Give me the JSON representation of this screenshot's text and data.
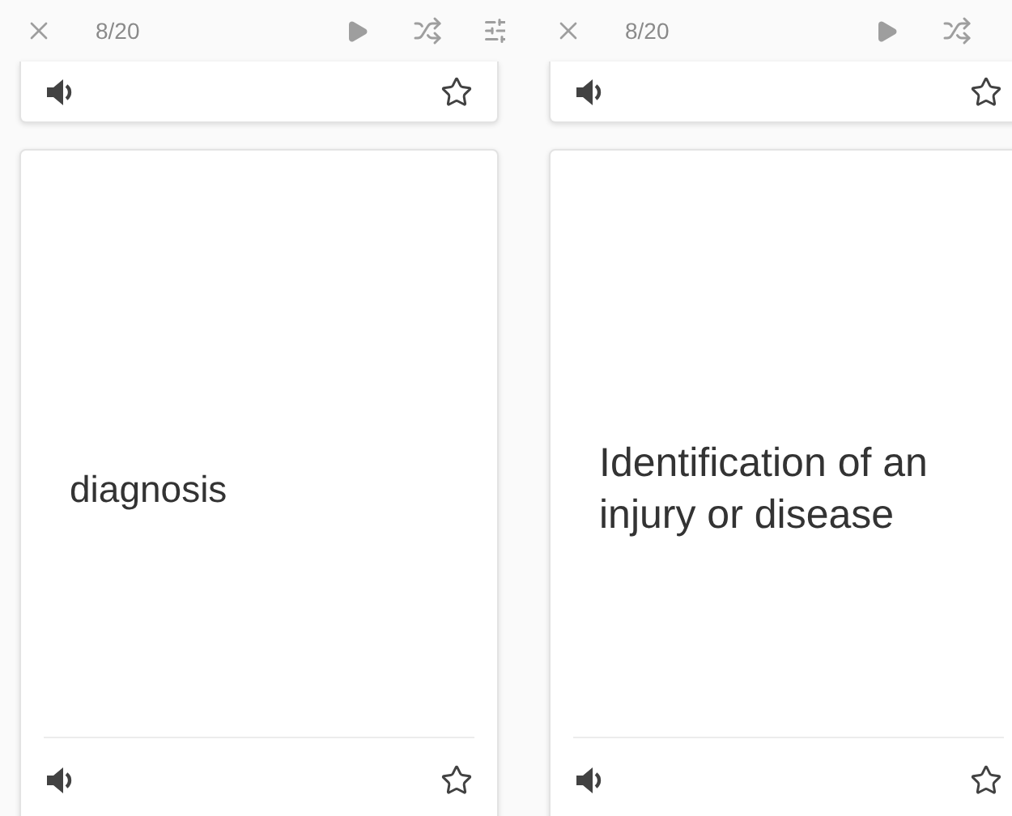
{
  "panels": [
    {
      "counter": "8/20",
      "previous_card": {
        "starred": false
      },
      "card": {
        "text": "diagnosis",
        "starred": false
      }
    },
    {
      "counter": "8/20",
      "previous_card": {
        "starred": false
      },
      "card": {
        "text": "Identification of an injury or disease",
        "starred": false
      }
    }
  ]
}
